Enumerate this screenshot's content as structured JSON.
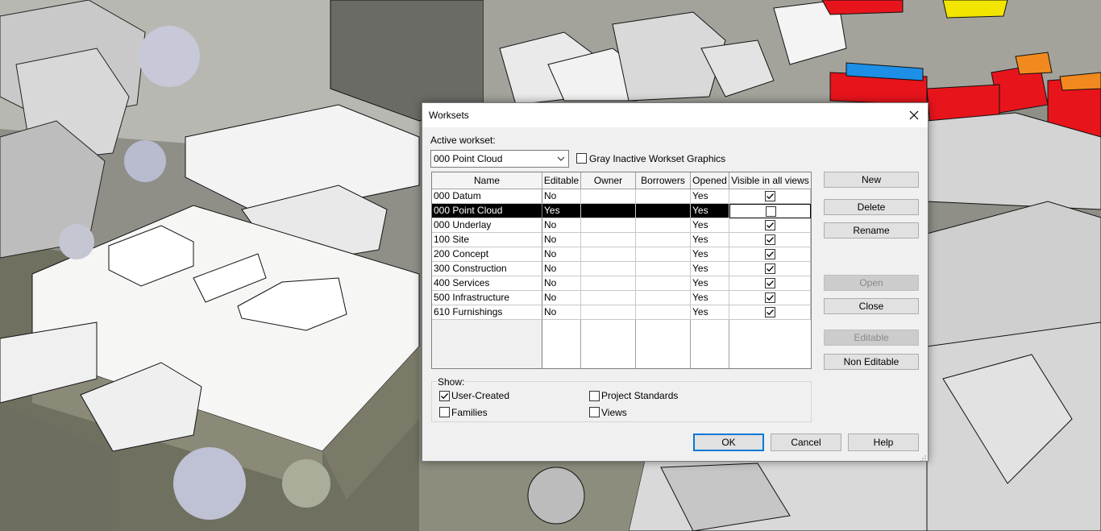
{
  "dialog": {
    "title": "Worksets",
    "active_workset_label": "Active workset:",
    "active_workset_value": "000 Point Cloud",
    "gray_inactive_label": "Gray Inactive Workset Graphics",
    "gray_inactive_checked": false
  },
  "table": {
    "headers": [
      "Name",
      "Editable",
      "Owner",
      "Borrowers",
      "Opened",
      "Visible in all views"
    ],
    "rows": [
      {
        "name": "000 Datum",
        "editable": "No",
        "owner": "",
        "borrowers": "",
        "opened": "Yes",
        "visible": true
      },
      {
        "name": "000 Point Cloud",
        "editable": "Yes",
        "owner": "",
        "borrowers": "",
        "opened": "Yes",
        "visible": false,
        "selected": true
      },
      {
        "name": "000 Underlay",
        "editable": "No",
        "owner": "",
        "borrowers": "",
        "opened": "Yes",
        "visible": true
      },
      {
        "name": "100 Site",
        "editable": "No",
        "owner": "",
        "borrowers": "",
        "opened": "Yes",
        "visible": true
      },
      {
        "name": "200 Concept",
        "editable": "No",
        "owner": "",
        "borrowers": "",
        "opened": "Yes",
        "visible": true
      },
      {
        "name": "300 Construction",
        "editable": "No",
        "owner": "",
        "borrowers": "",
        "opened": "Yes",
        "visible": true
      },
      {
        "name": "400 Services",
        "editable": "No",
        "owner": "",
        "borrowers": "",
        "opened": "Yes",
        "visible": true
      },
      {
        "name": "500 Infrastructure",
        "editable": "No",
        "owner": "",
        "borrowers": "",
        "opened": "Yes",
        "visible": true
      },
      {
        "name": "610 Furnishings",
        "editable": "No",
        "owner": "",
        "borrowers": "",
        "opened": "Yes",
        "visible": true
      }
    ]
  },
  "show": {
    "label": "Show:",
    "user_created": {
      "label": "User-Created",
      "checked": true
    },
    "families": {
      "label": "Families",
      "checked": false
    },
    "project_standards": {
      "label": "Project Standards",
      "checked": false
    },
    "views": {
      "label": "Views",
      "checked": false
    }
  },
  "buttons": {
    "new": "New",
    "delete": "Delete",
    "rename": "Rename",
    "open": "Open",
    "close": "Close",
    "editable": "Editable",
    "non_editable": "Non Editable",
    "ok": "OK",
    "cancel": "Cancel",
    "help": "Help"
  },
  "colors": {
    "dialog_bg": "#f0f0f0",
    "selection": "#000000",
    "ok_border": "#0078d7",
    "scene_red": "#e8141c",
    "scene_yellow": "#f2e600",
    "scene_blue": "#1e8fe6",
    "scene_orange": "#f08a1e"
  }
}
